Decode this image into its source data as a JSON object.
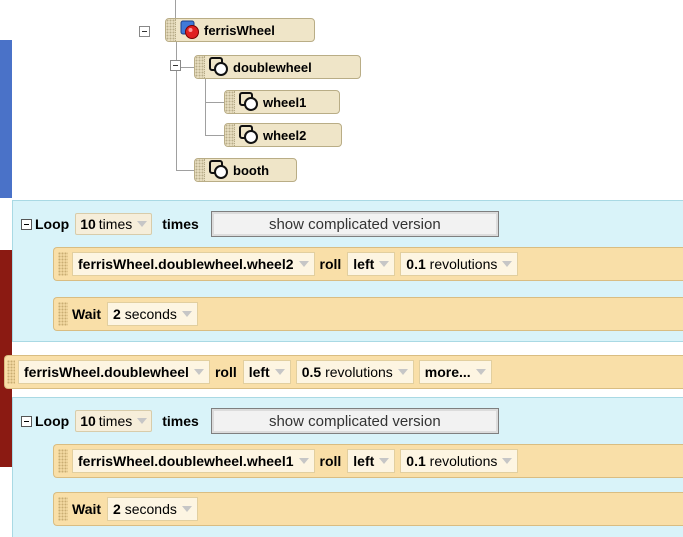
{
  "tree": {
    "nodes": [
      {
        "label": "ferrisWheel",
        "icon": "ferris-object-icon"
      },
      {
        "label": "doublewheel",
        "icon": "composite-object-icon"
      },
      {
        "label": "wheel1",
        "icon": "composite-object-icon"
      },
      {
        "label": "wheel2",
        "icon": "composite-object-icon"
      },
      {
        "label": "booth",
        "icon": "composite-object-icon"
      }
    ]
  },
  "editor": {
    "loop1": {
      "loop_label": "Loop",
      "count": "10",
      "count_unit": "times",
      "times_label": "times",
      "show_button": "show complicated version",
      "stmt1": {
        "object": "ferrisWheel.doublewheel.wheel2",
        "method": "roll",
        "direction": "left",
        "amount": "0.1",
        "unit": "revolutions"
      },
      "stmt2": {
        "label": "Wait",
        "amount": "2",
        "unit": "seconds"
      }
    },
    "stmt_mid": {
      "object": "ferrisWheel.doublewheel",
      "method": "roll",
      "direction": "left",
      "amount": "0.5",
      "unit": "revolutions",
      "more": "more..."
    },
    "loop2": {
      "loop_label": "Loop",
      "count": "10",
      "count_unit": "times",
      "times_label": "times",
      "show_button": "show complicated version",
      "stmt1": {
        "object": "ferrisWheel.doublewheel.wheel1",
        "method": "roll",
        "direction": "left",
        "amount": "0.1",
        "unit": "revolutions"
      },
      "stmt2": {
        "label": "Wait",
        "amount": "2",
        "unit": "seconds"
      }
    }
  },
  "colors": {
    "loop_bg": "#d9f3f9",
    "statement_bg": "#f9dfa8",
    "tree_node_bg": "#efe5c8"
  }
}
